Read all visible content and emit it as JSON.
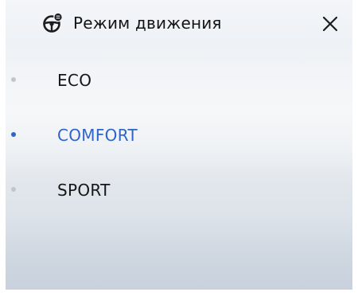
{
  "header": {
    "title": "Режим движения",
    "icon": "steering-wheel-icon",
    "close_icon": "close-icon"
  },
  "modes": [
    {
      "label": "ECO",
      "active": false
    },
    {
      "label": "COMFORT",
      "active": true
    },
    {
      "label": "SPORT",
      "active": false
    }
  ],
  "colors": {
    "accent": "#2f64c8",
    "text": "#161616",
    "inactive_dot": "#c2c6cc"
  }
}
